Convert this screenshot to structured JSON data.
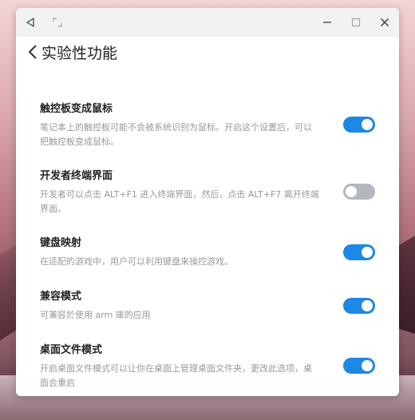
{
  "page": {
    "title": "实验性功能"
  },
  "settings": [
    {
      "title": "触控板变成鼠标",
      "description": "笔记本上的触控板可能不会被系统识别为鼠标。开启这个设置后，可以把触控板变成鼠标。",
      "enabled": true
    },
    {
      "title": "开发者终端界面",
      "description": "开发者可以点击 ALT+F1 进入终端界面，然后，点击 ALT+F7 离开终端界面。",
      "enabled": false
    },
    {
      "title": "键盘映射",
      "description": "在适配的游戏中，用户可以利用键盘来操控游戏。",
      "enabled": true
    },
    {
      "title": "兼容模式",
      "description": "可兼容於使用 arm 庫的应用",
      "enabled": true
    },
    {
      "title": "桌面文件模式",
      "description": "开启桌面文件模式可以让你在桌面上管理桌面文件夹，更改此选项，桌面会重启",
      "enabled": true
    }
  ],
  "icons": {
    "titlebar_left": [
      "back-triangle-icon",
      "expand-icon"
    ],
    "titlebar_right": [
      "minimize-icon",
      "maximize-icon",
      "close-icon"
    ],
    "header": "chevron-left-icon"
  },
  "colors": {
    "toggle_on": "#1e88e5",
    "toggle_off": "#b4b8bd"
  }
}
